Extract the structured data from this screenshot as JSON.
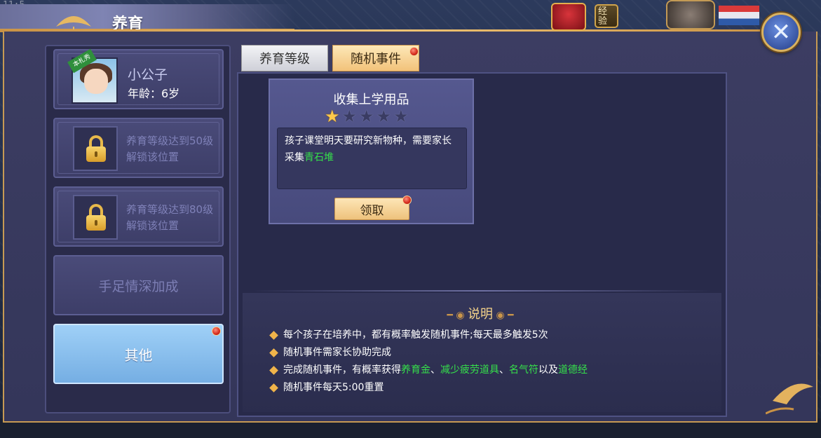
{
  "statusbar": {
    "time": "11:5"
  },
  "window": {
    "title": "养育"
  },
  "topbar": {
    "exp_icon_label": "经验",
    "icons": [
      "gift-icon",
      "exp-icon",
      "player-avatar",
      "flag-icon",
      "close-icon"
    ]
  },
  "sidebar": {
    "child": {
      "tag": "本札秀",
      "name": "小公子",
      "age": "年龄：6岁"
    },
    "locked_slots": [
      {
        "line1": "养育等级达到50级",
        "line2": "解锁该位置"
      },
      {
        "line1": "养育等级达到80级",
        "line2": "解锁该位置"
      }
    ],
    "bonus_label": "手足情深加成",
    "other_label": "其他"
  },
  "tabs": [
    {
      "label": "养育等级",
      "active": false
    },
    {
      "label": "随机事件",
      "active": true
    }
  ],
  "event_card": {
    "title": "收集上学用品",
    "stars_filled": 1,
    "stars_total": 5,
    "description_prefix": "孩子课堂明天要研究新物种，需要家长采集",
    "description_highlight": "青石堆",
    "claim_label": "领取"
  },
  "explanation": {
    "title": "说明",
    "items": [
      {
        "segments": [
          {
            "text": "每个孩子在培养中，都有概率触发随机事件;每天最多触发5次",
            "green": false
          }
        ]
      },
      {
        "segments": [
          {
            "text": "随机事件需家长协助完成",
            "green": false
          }
        ]
      },
      {
        "segments": [
          {
            "text": "完成随机事件，有概率获得",
            "green": false
          },
          {
            "text": "养育金",
            "green": true
          },
          {
            "text": "、",
            "green": false
          },
          {
            "text": "减少疲劳道具",
            "green": true
          },
          {
            "text": "、",
            "green": false
          },
          {
            "text": "名气符",
            "green": true
          },
          {
            "text": "以及",
            "green": false
          },
          {
            "text": "道德经",
            "green": true
          }
        ]
      },
      {
        "segments": [
          {
            "text": "随机事件每天5:00重置",
            "green": false
          }
        ]
      }
    ]
  },
  "colors": {
    "accent_gold": "#c99245",
    "highlight_green": "#35e04a",
    "active_tab": "#f2c27a",
    "other_button": "#75aee3"
  }
}
